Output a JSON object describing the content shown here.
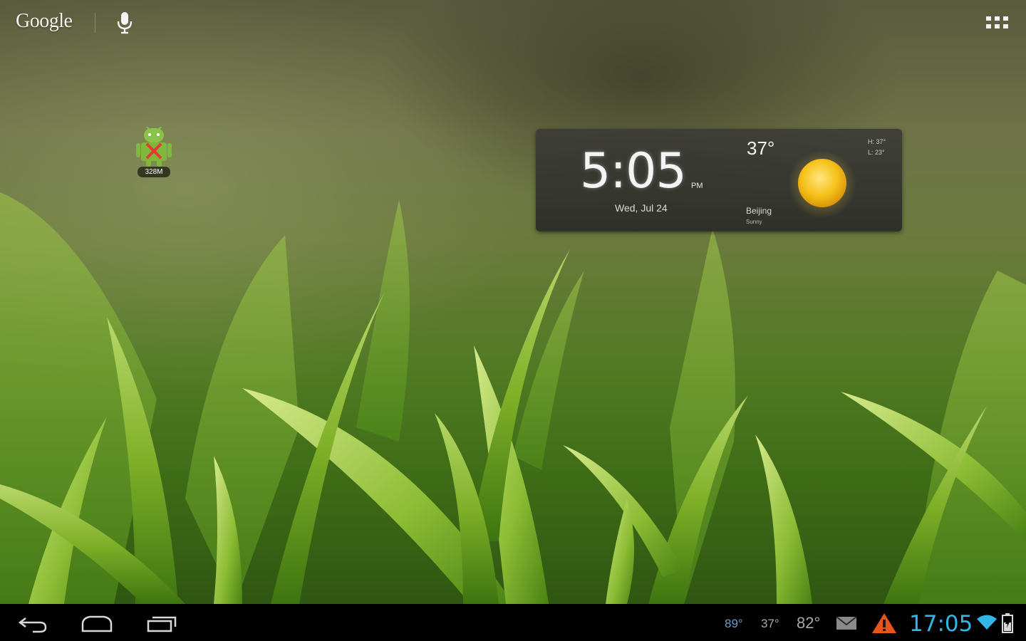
{
  "search": {
    "logo_text": "Google"
  },
  "desktop": {
    "shortcut_label": "328M"
  },
  "widget": {
    "time": "5:05",
    "ampm": "PM",
    "date": "Wed, Jul 24",
    "temperature": "37°",
    "high": "H: 37°",
    "low": "L: 23°",
    "city": "Beijing",
    "condition": "Sunny",
    "condition_icon": "sun-icon"
  },
  "statusbar": {
    "temp_1": "89°",
    "temp_2": "37°",
    "temp_3": "82°",
    "time": "17:05"
  },
  "colors": {
    "accent": "#33b5e5",
    "warning": "#e8541a"
  }
}
